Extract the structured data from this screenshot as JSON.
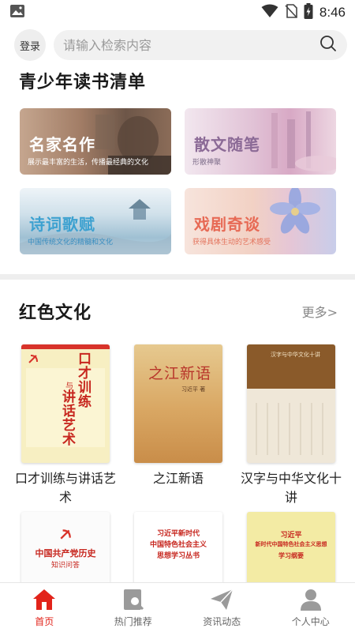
{
  "status_bar": {
    "time": "8:46"
  },
  "header": {
    "login_label": "登录",
    "search_placeholder": "请输入检索内容"
  },
  "reading_list": {
    "title": "青少年读书清单",
    "cards": [
      {
        "title": "名家名作",
        "subtitle": "展示最丰富的生活，传播最经典的文化"
      },
      {
        "title": "散文随笔",
        "subtitle": "形散神聚"
      },
      {
        "title": "诗词歌赋",
        "subtitle": "中国传统文化的精髓和文化"
      },
      {
        "title": "戏剧奇谈",
        "subtitle": "获得具体生动的艺术感受"
      }
    ]
  },
  "red_culture": {
    "title": "红色文化",
    "more_label": "更多>",
    "books": [
      {
        "title": "口才训练与讲话艺术",
        "cover": {
          "main": "口才训练",
          "sub": "讲话艺术",
          "mid": "与"
        }
      },
      {
        "title": "之江新语",
        "cover": {
          "main": "之江新语",
          "author": "习近平 著"
        }
      },
      {
        "title": "汉字与中华文化十讲",
        "cover": {
          "main": "汉字与中华文化十讲"
        }
      },
      {
        "title": "",
        "cover": {
          "main": "中国共产党历史",
          "sub": "知识问答"
        }
      },
      {
        "title": "",
        "cover": {
          "line1": "习近平新时代",
          "line2": "中国特色社会主义",
          "line3": "思想学习丛书"
        }
      },
      {
        "title": "",
        "cover": {
          "line1": "习近平",
          "line2": "新时代中国特色社会主义思想",
          "line3": "学习纲要"
        }
      }
    ]
  },
  "bottom_nav": {
    "items": [
      {
        "label": "首页",
        "active": true
      },
      {
        "label": "热门推荐",
        "active": false
      },
      {
        "label": "资讯动态",
        "active": false
      },
      {
        "label": "个人中心",
        "active": false
      }
    ]
  },
  "colors": {
    "accent": "#e2231a",
    "nav_inactive": "#9a9a9a"
  }
}
